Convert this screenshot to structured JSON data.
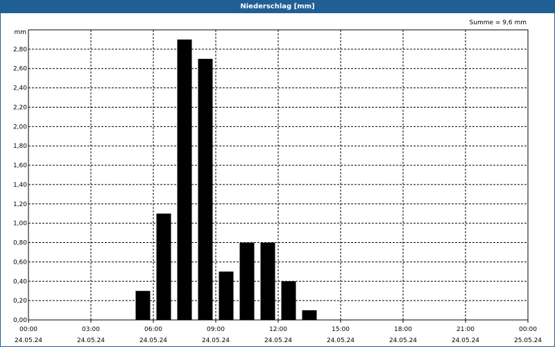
{
  "window": {
    "title": "Niederschlag [mm]"
  },
  "chart_data": {
    "type": "bar",
    "title": "Niederschlag [mm]",
    "ylabel": "mm",
    "annotation": "Summe = 9,6 mm",
    "ylim": [
      0,
      3.0
    ],
    "yticks": [
      "0,00",
      "0,20",
      "0,40",
      "0,60",
      "0,80",
      "1,00",
      "1,20",
      "1,40",
      "1,60",
      "1,80",
      "2,00",
      "2,20",
      "2,40",
      "2,60",
      "2,80"
    ],
    "xticks": [
      {
        "time": "00:00",
        "date": "24.05.24"
      },
      {
        "time": "03:00",
        "date": "24.05.24"
      },
      {
        "time": "06:00",
        "date": "24.05.24"
      },
      {
        "time": "09:00",
        "date": "24.05.24"
      },
      {
        "time": "12:00",
        "date": "24.05.24"
      },
      {
        "time": "15:00",
        "date": "24.05.24"
      },
      {
        "time": "18:00",
        "date": "24.05.24"
      },
      {
        "time": "21:00",
        "date": "24.05.24"
      },
      {
        "time": "00:00",
        "date": "25.05.24"
      }
    ],
    "xlim_hours": [
      0,
      24
    ],
    "bars": [
      {
        "hour": 5.5,
        "value": 0.3
      },
      {
        "hour": 6.5,
        "value": 1.1
      },
      {
        "hour": 7.5,
        "value": 2.9
      },
      {
        "hour": 8.5,
        "value": 2.7
      },
      {
        "hour": 9.5,
        "value": 0.5
      },
      {
        "hour": 10.5,
        "value": 0.8
      },
      {
        "hour": 11.5,
        "value": 0.8
      },
      {
        "hour": 12.5,
        "value": 0.4
      },
      {
        "hour": 13.5,
        "value": 0.1
      }
    ],
    "grid": true,
    "bar_color": "#000000"
  }
}
